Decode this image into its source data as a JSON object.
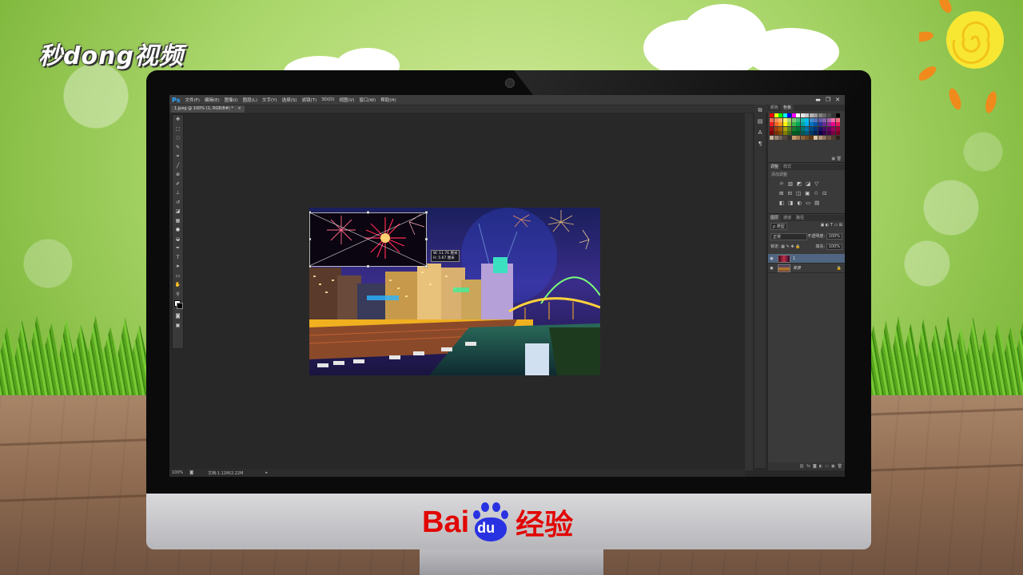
{
  "watermark": {
    "brand_top": "秒dong视频"
  },
  "monitor_brand": {
    "bai": "Bai",
    "du": "du",
    "jingyan": "经验"
  },
  "photoshop": {
    "app_logo": "Ps",
    "menu": [
      "文件(F)",
      "编辑(E)",
      "图像(I)",
      "图层(L)",
      "文字(Y)",
      "选择(S)",
      "滤镜(T)",
      "3D(D)",
      "视图(V)",
      "窗口(W)",
      "帮助(H)"
    ],
    "window_buttons": [
      "▬",
      "❐",
      "✕"
    ],
    "document_tab": "1.jpeg @ 100% (1, RGB/8#) *",
    "tab_close": "×",
    "tools": [
      "move-icon",
      "marquee-icon",
      "lasso-icon",
      "quick-select-icon",
      "crop-icon",
      "eyedropper-icon",
      "healing-icon",
      "brush-icon",
      "stamp-icon",
      "history-brush-icon",
      "eraser-icon",
      "gradient-icon",
      "blur-icon",
      "dodge-icon",
      "pen-icon",
      "type-icon",
      "path-select-icon",
      "shape-icon",
      "hand-icon",
      "zoom-icon"
    ],
    "transform_readout": {
      "w": "W: 11.76 厘米",
      "h": "H: 5.67 厘米"
    },
    "status": {
      "zoom": "100%",
      "doc": "文档:1.11M/2.22M"
    },
    "swatches_panel": {
      "tabs": [
        "颜色",
        "色板"
      ],
      "active_tab": 1
    },
    "adjustments_panel": {
      "tabs": [
        "调整",
        "样式"
      ],
      "label": "添加调整",
      "row1": [
        "☼",
        "▥",
        "◩",
        "◪",
        "▽"
      ],
      "row2": [
        "⊞",
        "⊟",
        "◫",
        "▣",
        "♲",
        "⊡"
      ],
      "row3": [
        "◧",
        "◨",
        "◐",
        "▭",
        "▤"
      ]
    },
    "layers_panel": {
      "tabs": [
        "图层",
        "通道",
        "路径"
      ],
      "kind_filter": "ρ 类型",
      "blend_mode": "正常",
      "opacity_label": "不透明度:",
      "opacity_value": "100%",
      "lock_label": "锁定:",
      "fill_label": "填充:",
      "fill_value": "100%",
      "layers": [
        {
          "name": "1",
          "selected": true
        },
        {
          "name": "背景",
          "selected": false,
          "locked": true
        }
      ]
    }
  }
}
